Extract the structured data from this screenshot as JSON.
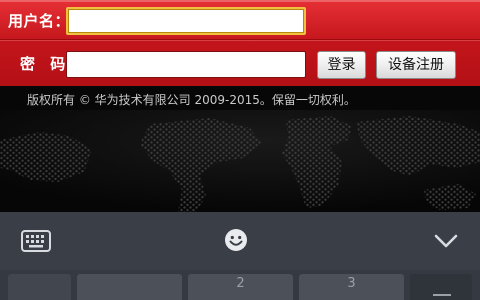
{
  "login": {
    "username_label": "用户名：",
    "password_label": "密 码：",
    "username_value": "",
    "password_value": "",
    "login_button": "登录",
    "register_button": "设备注册"
  },
  "footer": {
    "copyright": "版权所有 © 华为技术有限公司 2009-2015。保留一切权利。"
  },
  "keyboard": {
    "toolbar_icons": [
      "keyboard-icon",
      "emoji-icon",
      "chevron-down-icon"
    ],
    "keys": [
      "",
      "",
      "2",
      "3",
      ""
    ]
  },
  "colors": {
    "brand_red": "#c2151b",
    "page_background": "#070707",
    "keyboard_background": "#353a42"
  }
}
